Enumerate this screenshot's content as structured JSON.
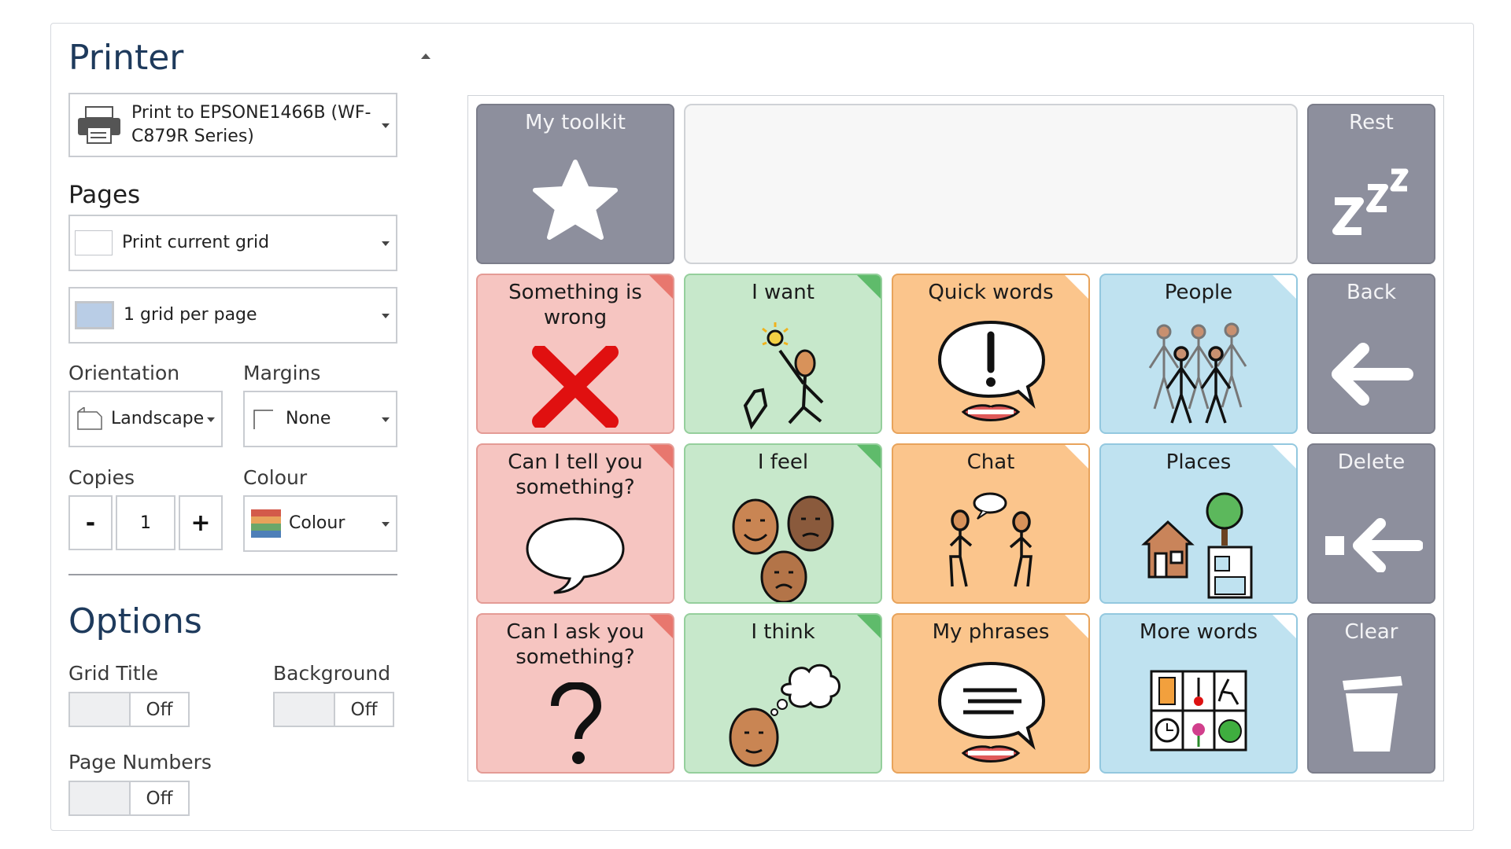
{
  "printer": {
    "heading": "Printer",
    "selected_line1": "Print to EPSONE1466B (WF-",
    "selected_line2": "C879R Series)"
  },
  "pages": {
    "heading": "Pages",
    "range": "Print current grid",
    "layout": "1 grid per page"
  },
  "orientation": {
    "label": "Orientation",
    "value": "Landscape"
  },
  "margins": {
    "label": "Margins",
    "value": "None"
  },
  "copies": {
    "label": "Copies",
    "minus": "-",
    "value": "1",
    "plus": "+"
  },
  "colour": {
    "label": "Colour",
    "value": "Colour"
  },
  "options": {
    "heading": "Options",
    "grid_title": {
      "label": "Grid Title",
      "state": "Off"
    },
    "background": {
      "label": "Background",
      "state": "Off"
    },
    "page_numbers": {
      "label": "Page Numbers",
      "state": "Off"
    }
  },
  "grid": {
    "toolkit": "My toolkit",
    "rest": "Rest",
    "back": "Back",
    "delete": "Delete",
    "clear": "Clear",
    "row1": [
      "Something is wrong",
      "I want",
      "Quick words",
      "People"
    ],
    "row2": [
      "Can I tell you something?",
      "I feel",
      "Chat",
      "Places"
    ],
    "row3": [
      "Can I ask you something?",
      "I think",
      "My phrases",
      "More words"
    ]
  },
  "colors": {
    "red": "#f6c5c1",
    "green": "#c7e8cb",
    "orange": "#fbc58c",
    "blue": "#bfe2f0",
    "grey": "#8d8f9d",
    "heading": "#1e3a5c"
  }
}
